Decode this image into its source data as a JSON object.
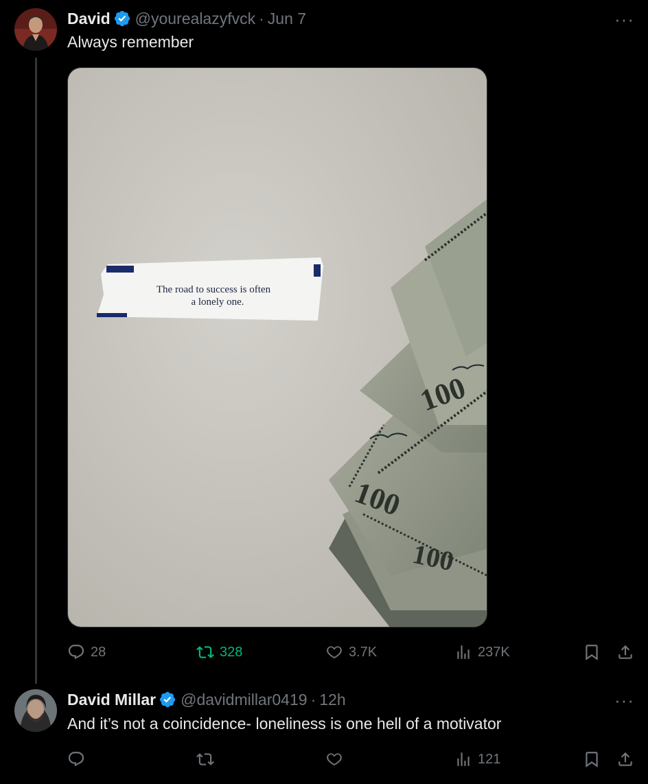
{
  "tweets": [
    {
      "author": {
        "name": "David",
        "handle": "@yourealazyfvck",
        "verified": true
      },
      "time": "Jun 7",
      "text": "Always remember",
      "media": {
        "fortune_line1": "The road to success is often",
        "fortune_line2": "a lonely one.",
        "bill_label": "100"
      },
      "stats": {
        "replies": "28",
        "reposts": "328",
        "likes": "3.7K",
        "views": "237K"
      },
      "reposted_by_viewer": true
    },
    {
      "author": {
        "name": "David Millar",
        "handle": "@davidmillar0419",
        "verified": true
      },
      "time": "12h",
      "text": "And it’s not a coincidence- loneliness is one hell of a motivator",
      "stats": {
        "replies": "",
        "reposts": "",
        "likes": "",
        "views": "121"
      }
    }
  ],
  "ui": {
    "separator": "·",
    "more": "···"
  },
  "colors": {
    "background": "#000000",
    "text": "#e7e9ea",
    "muted": "#71767b",
    "repost_active": "#00ba7c",
    "verified": "#1d9bf0"
  },
  "icons": [
    "reply-icon",
    "repost-icon",
    "like-icon",
    "views-icon",
    "bookmark-icon",
    "share-icon",
    "verified-badge-icon",
    "more-icon"
  ]
}
